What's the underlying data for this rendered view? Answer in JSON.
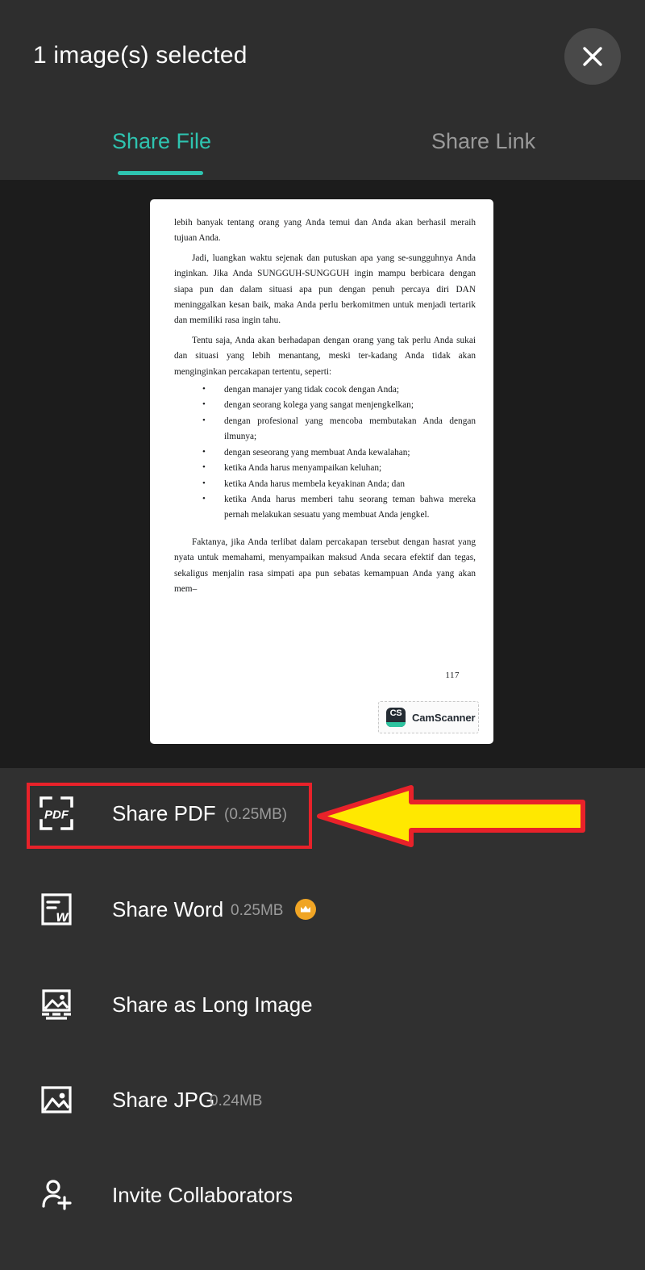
{
  "header": {
    "title": "1 image(s) selected",
    "close_icon": "close-icon"
  },
  "tabs": [
    {
      "label": "Share File",
      "active": true
    },
    {
      "label": "Share Link",
      "active": false
    }
  ],
  "preview": {
    "document": {
      "paragraphs": [
        "lebih banyak tentang orang yang Anda temui dan Anda akan berhasil meraih tujuan Anda.",
        "Jadi, luangkan waktu sejenak dan putuskan apa yang se-sungguhnya Anda inginkan. Jika Anda SUNGGUH-SUNGGUH ingin mampu berbicara dengan siapa pun dan dalam situasi apa pun dengan penuh percaya diri DAN meninggalkan kesan baik, maka Anda perlu berkomitmen untuk menjadi tertarik dan memiliki rasa ingin tahu.",
        "Tentu saja, Anda akan berhadapan dengan orang yang tak perlu Anda sukai dan situasi yang lebih menantang, meski ter-kadang Anda tidak akan menginginkan percakapan tertentu, seperti:"
      ],
      "bullets": [
        "dengan manajer yang tidak cocok dengan Anda;",
        "dengan seorang kolega yang sangat menjengkelkan;",
        "dengan profesional yang mencoba membutakan Anda dengan ilmunya;",
        "dengan seseorang yang membuat Anda kewalahan;",
        "ketika Anda harus menyampaikan keluhan;",
        "ketika Anda harus membela keyakinan Anda; dan",
        "ketika Anda harus memberi tahu seorang teman bahwa mereka pernah melakukan sesuatu yang membuat Anda jengkel."
      ],
      "closing_paragraph": "Faktanya, jika Anda terlibat dalam percakapan tersebut dengan hasrat yang nyata untuk memahami, menyampaikan maksud Anda secara efektif dan tegas, sekaligus menjalin rasa simpati apa pun sebatas kemampuan Anda yang akan mem–",
      "page_number": "117",
      "watermark": {
        "logo_text": "CS",
        "name": "CamScanner"
      }
    }
  },
  "fab": {
    "icon": "more-options-icon",
    "color": "#2e7d4f"
  },
  "options": [
    {
      "name": "share-pdf",
      "icon": "pdf-file-icon",
      "label": "Share PDF",
      "size": "(0.25MB)",
      "premium": false
    },
    {
      "name": "share-word",
      "icon": "word-file-icon",
      "label": "Share Word",
      "size": "0.25MB",
      "premium": true
    },
    {
      "name": "share-as-long-image",
      "icon": "long-image-icon",
      "label": "Share as Long Image",
      "size": "",
      "premium": false
    },
    {
      "name": "share-jpg",
      "icon": "image-icon",
      "label": "Share JPG",
      "size": "0.24MB",
      "premium": false
    },
    {
      "name": "invite-collaborators",
      "icon": "person-add-icon",
      "label": "Invite Collaborators",
      "size": "",
      "premium": false
    }
  ],
  "annotations": {
    "highlight_color": "#e8222a",
    "arrow_fill": "#ffe800",
    "arrow_stroke": "#e8222a",
    "arrow_points_to": "share-pdf"
  },
  "colors": {
    "accent_teal": "#2ec4b0",
    "background": "#2e2e2e",
    "preview_background": "#1c1c1c",
    "premium_badge": "#f0a525"
  }
}
